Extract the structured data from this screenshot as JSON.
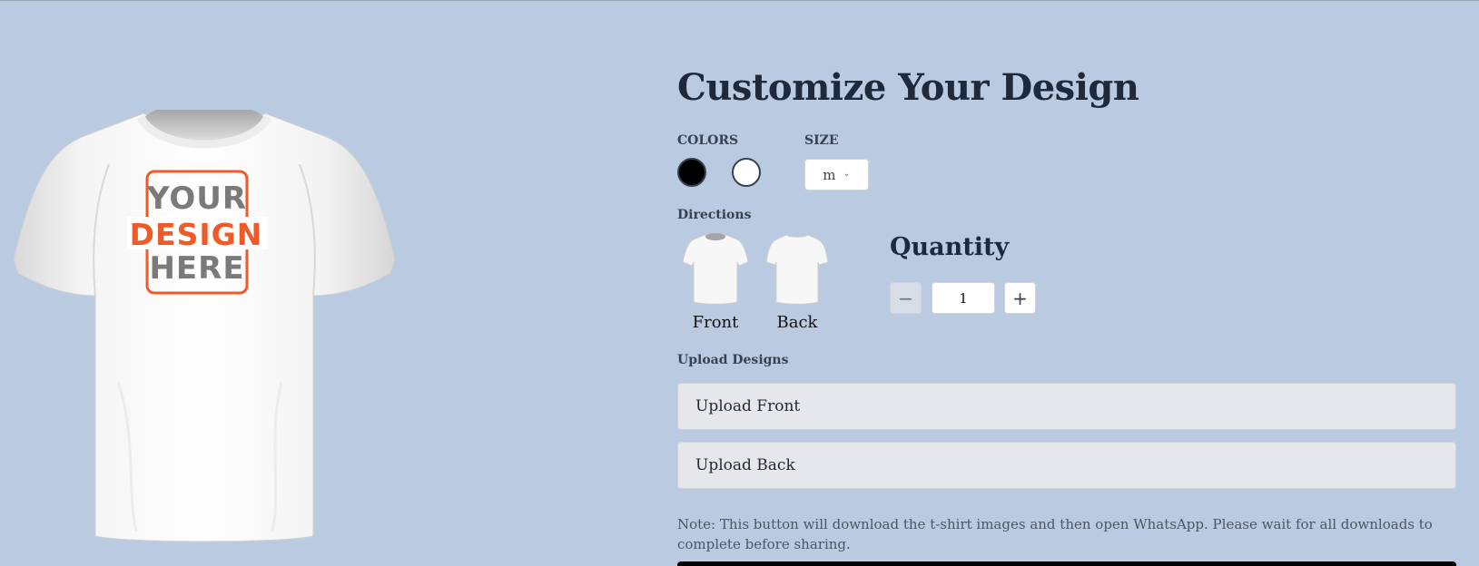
{
  "preview": {
    "print_lines": [
      "YOUR",
      "DESIGN",
      "HERE"
    ],
    "icon": "tshirt-front-preview",
    "accent": "#f05a28",
    "text_gray": "#7a7a7a"
  },
  "customizer": {
    "title": "Customize Your Design",
    "colors_label": "COLORS",
    "colors": [
      {
        "name": "black",
        "hex": "#000000"
      },
      {
        "name": "white",
        "hex": "#ffffff"
      }
    ],
    "size_label": "SIZE",
    "size_value": "m",
    "directions_label": "Directions",
    "directions": [
      {
        "label": "Front",
        "icon": "tshirt-front-icon"
      },
      {
        "label": "Back",
        "icon": "tshirt-back-icon"
      }
    ],
    "quantity_label": "Quantity",
    "quantity_value": "1",
    "minus_symbol": "−",
    "plus_symbol": "+",
    "upload_label": "Upload Designs",
    "upload_front": "Upload Front",
    "upload_back": "Upload Back",
    "note": "Note: This button will download the t-shirt images and then open WhatsApp. Please wait for all downloads to complete before sharing."
  }
}
